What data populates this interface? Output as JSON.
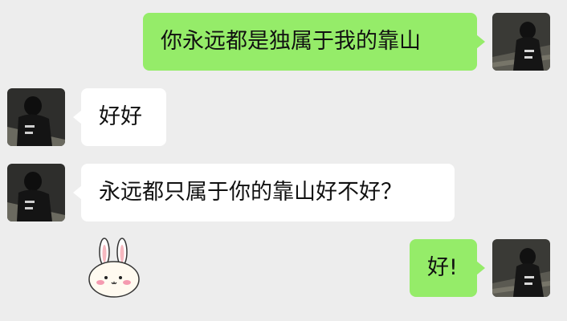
{
  "chat": {
    "messages": [
      {
        "sender": "me",
        "text": "你永远都是独属于我的靠山"
      },
      {
        "sender": "other",
        "text": "好好"
      },
      {
        "sender": "other",
        "text": "永远都只属于你的靠山好不好？"
      },
      {
        "sender": "other",
        "sticker": "bunny-sticker"
      },
      {
        "sender": "me",
        "text": "好!"
      }
    ]
  },
  "colors": {
    "background": "#ededed",
    "outgoing_bubble": "#95ec69",
    "incoming_bubble": "#ffffff"
  }
}
